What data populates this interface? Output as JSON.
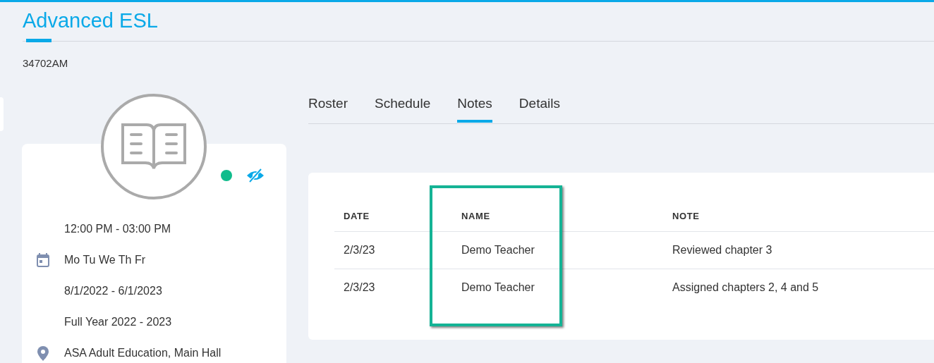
{
  "title": "Advanced ESL",
  "code": "34702AM",
  "course": {
    "active": true,
    "visible": false,
    "info": [
      {
        "kind": "time",
        "text": "12:00 PM - 03:00 PM"
      },
      {
        "kind": "days",
        "text": "Mo Tu We Th Fr"
      },
      {
        "kind": "dates",
        "text": "8/1/2022 - 6/1/2023"
      },
      {
        "kind": "term",
        "text": "Full Year 2022 - 2023"
      },
      {
        "kind": "location",
        "text": "ASA Adult Education, Main Hall"
      }
    ]
  },
  "tabs": [
    {
      "label": "Roster",
      "selected": false
    },
    {
      "label": "Schedule",
      "selected": false
    },
    {
      "label": "Notes",
      "selected": true
    },
    {
      "label": "Details",
      "selected": false
    }
  ],
  "table": {
    "columns": [
      {
        "label": "DATE",
        "highlighted": false
      },
      {
        "label": "NAME",
        "highlighted": true
      },
      {
        "label": "NOTE",
        "highlighted": false
      }
    ],
    "rows": [
      [
        "2/3/23",
        "Demo Teacher",
        "Reviewed chapter 3"
      ],
      [
        "2/3/23",
        "Demo Teacher",
        "Assigned chapters 2, 4 and 5"
      ]
    ]
  }
}
